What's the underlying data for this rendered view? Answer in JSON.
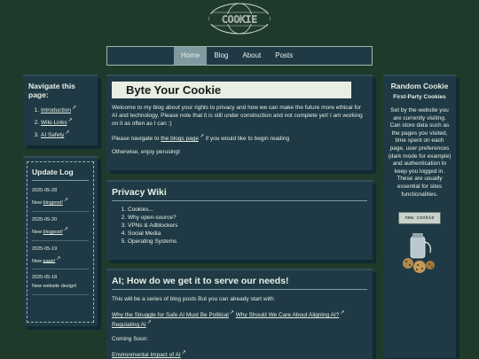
{
  "logo": {
    "text": "COOKIE"
  },
  "nav": {
    "items": [
      {
        "label": "Home"
      },
      {
        "label": "Blog"
      },
      {
        "label": "About"
      },
      {
        "label": "Posts"
      }
    ]
  },
  "left_nav": {
    "title": "Navigate this page:",
    "items": [
      {
        "label": "Introduction"
      },
      {
        "label": "Wiki-Links"
      },
      {
        "label": "AI Safety"
      }
    ]
  },
  "update_log": {
    "title": "Update Log",
    "entries": [
      {
        "date": "2025-05-28",
        "prefix": "New ",
        "link": "blogpost!"
      },
      {
        "date": "2025-05-20",
        "prefix": "New ",
        "link": "blogpost!"
      },
      {
        "date": "2025-05-19",
        "prefix": "New ",
        "link": "page!"
      },
      {
        "date": "2025-05-18",
        "prefix": "New website design!",
        "link": ""
      }
    ]
  },
  "intro": {
    "title": "Byte Your Cookie",
    "paragraph1": "Welcome to my blog about your rights to privacy and how we can make the future more ethical for AI and technology. Please note that it is still under construction and not complete yet! I am working on it as often as I can :)",
    "nav_prefix": "Please navigate to ",
    "nav_link": "the blogs page",
    "nav_suffix": " if you would like to begin reading",
    "paragraph3": "Otherwise, enjoy perusing!"
  },
  "privacy_wiki": {
    "title": "Privacy Wiki",
    "items": [
      "Cookies...",
      "Why open-source?",
      "VPNs & Adblockers",
      "Social Media",
      "Operating Systems"
    ]
  },
  "ai_section": {
    "title": "AI; How do we get it to serve our needs!",
    "intro": "This will be a series of blog posts But you can already start with:",
    "links": [
      "Why the Struggle for Safe AI Must Be Political",
      "Why Should We Care About Aligning AI?",
      "Regulating AI"
    ],
    "coming_soon": "Coming Soon:",
    "upcoming": [
      "Environmental Impact of AI"
    ]
  },
  "random_cookie": {
    "title": "Random Cookie",
    "subtitle": "First-Party Cookies",
    "text": "Set by the website you are currently visiting. Can store data such as the pages you visited, time spent on each page, user preferences (dark mode for example) and authentication to keep you logged in. These are usually essential for sites functionalities.",
    "button": "new cookie"
  },
  "ext_glyph": "↗"
}
